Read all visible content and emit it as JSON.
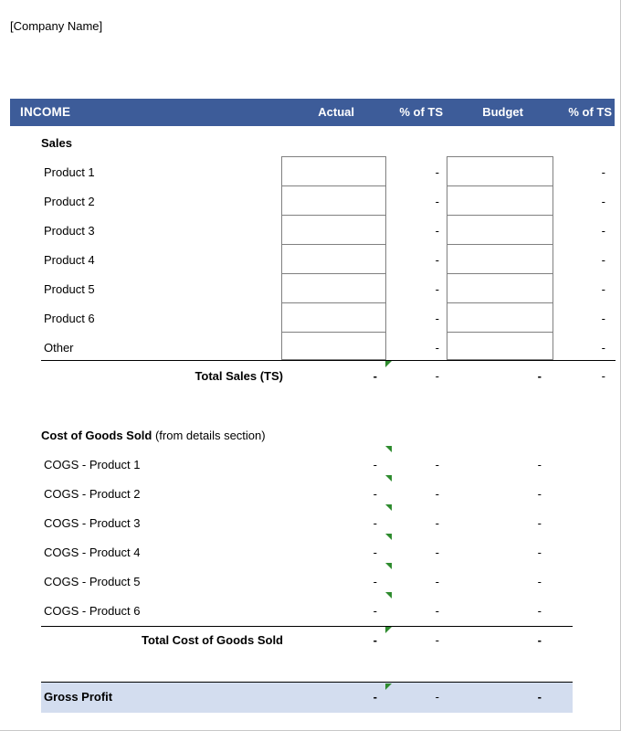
{
  "document": {
    "company_name": "[Company Name]"
  },
  "header": {
    "section_label": "INCOME",
    "columns": [
      "Actual",
      "% of TS",
      "Budget",
      "% of TS"
    ],
    "background_color": "#3D5C99",
    "text_color": "#FFFFFF"
  },
  "sales": {
    "section_title": "Sales",
    "rows": [
      {
        "label": "Product 1",
        "actual": "",
        "pct_ts_actual": "-",
        "budget": "",
        "pct_ts_budget": "-"
      },
      {
        "label": "Product 2",
        "actual": "",
        "pct_ts_actual": "-",
        "budget": "",
        "pct_ts_budget": "-"
      },
      {
        "label": "Product 3",
        "actual": "",
        "pct_ts_actual": "-",
        "budget": "",
        "pct_ts_budget": "-"
      },
      {
        "label": "Product 4",
        "actual": "",
        "pct_ts_actual": "-",
        "budget": "",
        "pct_ts_budget": "-"
      },
      {
        "label": "Product 5",
        "actual": "",
        "pct_ts_actual": "-",
        "budget": "",
        "pct_ts_budget": "-"
      },
      {
        "label": "Product 6",
        "actual": "",
        "pct_ts_actual": "-",
        "budget": "",
        "pct_ts_budget": "-"
      },
      {
        "label": "Other",
        "actual": "",
        "pct_ts_actual": "-",
        "budget": "",
        "pct_ts_budget": "-"
      }
    ],
    "total": {
      "label": "Total Sales (TS)",
      "actual": "-",
      "pct_ts_actual": "-",
      "budget": "-",
      "pct_ts_budget": "-"
    }
  },
  "cogs": {
    "section_title": "Cost of Goods Sold",
    "section_note": " (from details section)",
    "rows": [
      {
        "label": "COGS - Product 1",
        "actual": "-",
        "pct_ts_actual": "-",
        "budget": "-"
      },
      {
        "label": "COGS - Product 2",
        "actual": "-",
        "pct_ts_actual": "-",
        "budget": "-"
      },
      {
        "label": "COGS - Product 3",
        "actual": "-",
        "pct_ts_actual": "-",
        "budget": "-"
      },
      {
        "label": "COGS - Product 4",
        "actual": "-",
        "pct_ts_actual": "-",
        "budget": "-"
      },
      {
        "label": "COGS - Product 5",
        "actual": "-",
        "pct_ts_actual": "-",
        "budget": "-"
      },
      {
        "label": "COGS - Product 6",
        "actual": "-",
        "pct_ts_actual": "-",
        "budget": "-"
      }
    ],
    "total": {
      "label": "Total Cost of Goods Sold",
      "actual": "-",
      "pct_ts_actual": "-",
      "budget": "-"
    }
  },
  "gross_profit": {
    "label": "Gross Profit",
    "actual": "-",
    "pct_ts_actual": "-",
    "budget": "-",
    "background_color": "#D3DDEF"
  },
  "markers": {
    "comment_indicator_color": "#2E8B2E"
  }
}
